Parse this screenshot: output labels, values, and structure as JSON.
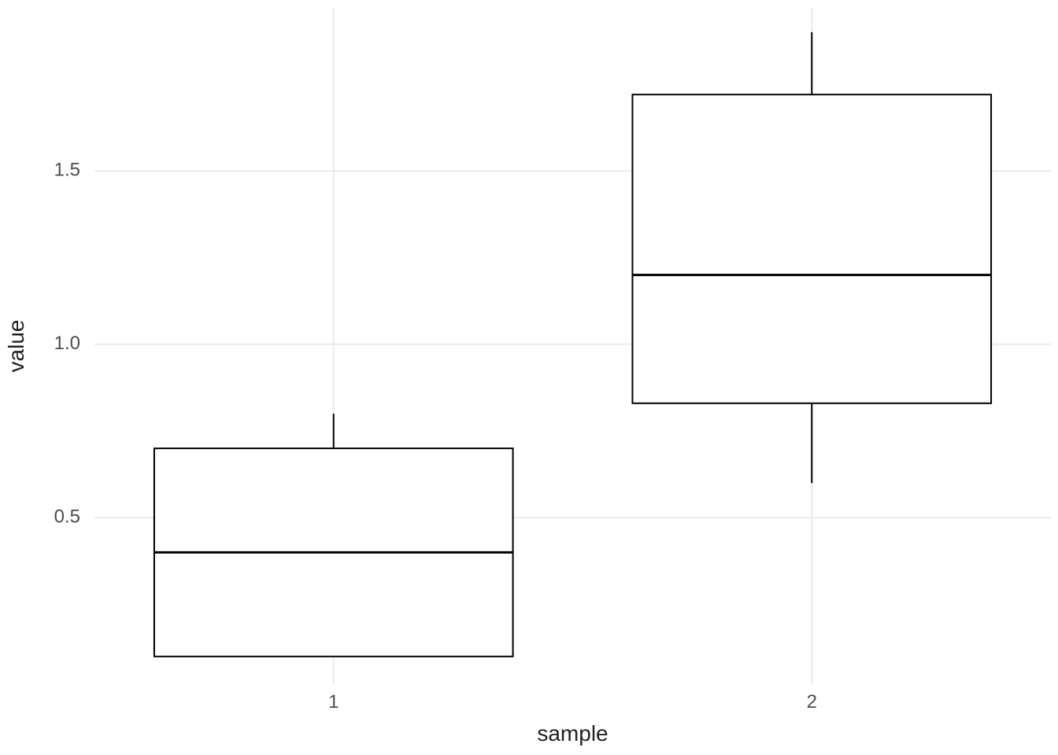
{
  "chart_data": {
    "type": "boxplot",
    "xlabel": "sample",
    "ylabel": "value",
    "categories": [
      "1",
      "2"
    ],
    "y_ticks": [
      0.5,
      1.0,
      1.5
    ],
    "ylim": [
      0.02,
      1.97
    ],
    "series": [
      {
        "name": "1",
        "min": 0.1,
        "q1": 0.1,
        "median": 0.4,
        "q3": 0.7,
        "max": 0.8
      },
      {
        "name": "2",
        "min": 0.6,
        "q1": 0.83,
        "median": 1.2,
        "q3": 1.72,
        "max": 1.9
      }
    ]
  }
}
